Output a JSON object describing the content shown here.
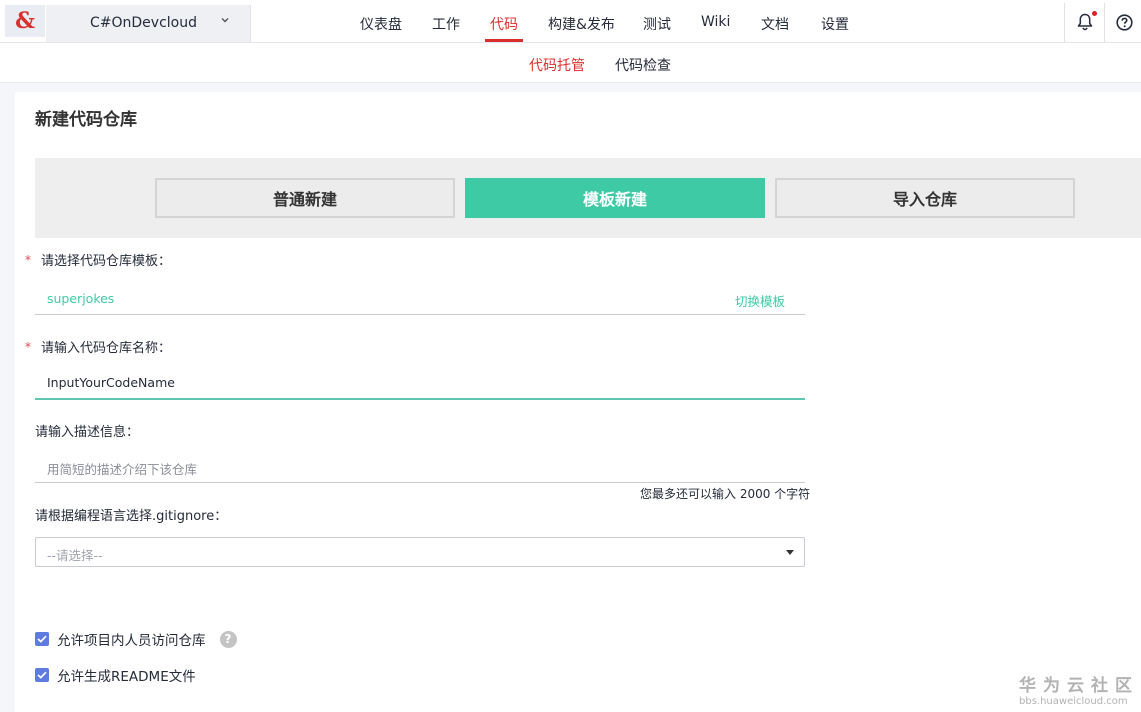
{
  "app": {
    "logo_text": "&",
    "project_name": "C#OnDevcloud"
  },
  "nav": {
    "items": [
      {
        "label": "仪表盘"
      },
      {
        "label": "工作"
      },
      {
        "label": "代码"
      },
      {
        "label": "构建&发布"
      },
      {
        "label": "测试"
      },
      {
        "label": "Wiki"
      },
      {
        "label": "文档"
      },
      {
        "label": "设置"
      }
    ],
    "active": "代码"
  },
  "subnav": {
    "items": [
      {
        "label": "代码托管"
      },
      {
        "label": "代码检查"
      }
    ],
    "active": "代码托管"
  },
  "page": {
    "title": "新建代码仓库"
  },
  "modes": {
    "items": [
      {
        "label": "普通新建"
      },
      {
        "label": "模板新建"
      },
      {
        "label": "导入仓库"
      }
    ],
    "active": "模板新建"
  },
  "form": {
    "template": {
      "required_mark": "*",
      "label": "请选择代码仓库模板：",
      "value": "superjokes",
      "switch_label": "切换模板"
    },
    "repo_name": {
      "required_mark": "*",
      "label": "请输入代码仓库名称：",
      "value": "InputYourCodeName"
    },
    "description": {
      "label": "请输入描述信息：",
      "placeholder": "用简短的描述介绍下该仓库",
      "counter": "您最多还可以输入 2000 个字符"
    },
    "gitignore": {
      "label": "请根据编程语言选择.gitignore：",
      "selected": "--请选择--"
    },
    "checkboxes": [
      {
        "label": "允许项目内人员访问仓库",
        "checked": true,
        "help": "?"
      },
      {
        "label": "允许生成README文件",
        "checked": true
      }
    ]
  },
  "watermark": {
    "line1": "华为云社区",
    "line2": "bbs.huaweicloud.com"
  },
  "colors": {
    "accent_red": "#d9302d",
    "teal": "#3ecaa5",
    "checkbox_blue": "#5e7ce0"
  }
}
